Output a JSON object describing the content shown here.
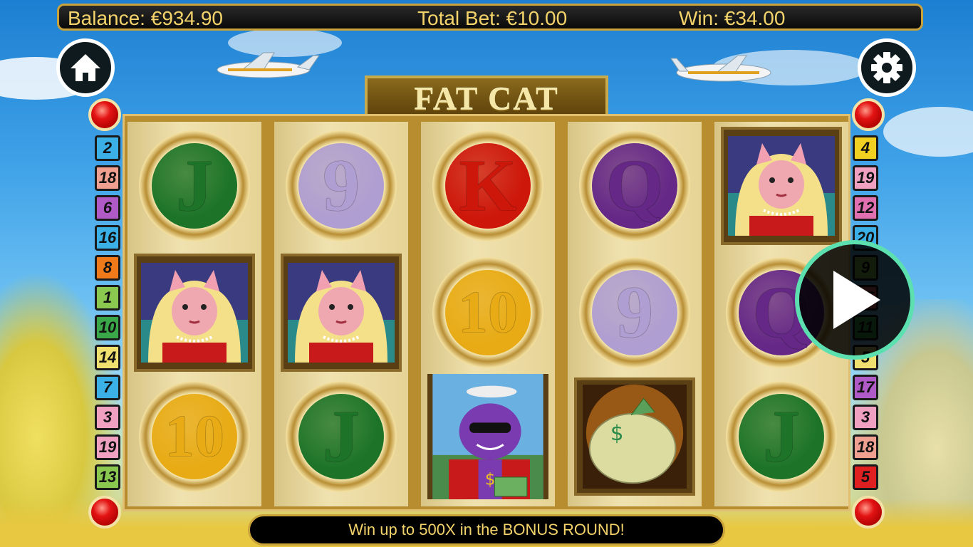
{
  "header": {
    "balance": "Balance: €934.90",
    "total_bet": "Total Bet: €10.00",
    "win": "Win: €34.00"
  },
  "logo": {
    "title": "FAT CAT"
  },
  "buttons": {
    "home_icon": "home-icon",
    "settings_icon": "gear-icon",
    "play_icon": "play-icon"
  },
  "reels": [
    [
      {
        "type": "coin",
        "label": "J",
        "color": "#1e7a2a"
      },
      {
        "type": "cat"
      },
      {
        "type": "coin",
        "label": "10",
        "color": "#f4b416"
      }
    ],
    [
      {
        "type": "coin",
        "label": "9",
        "color": "#b8a6dc"
      },
      {
        "type": "cat"
      },
      {
        "type": "coin",
        "label": "J",
        "color": "#1e7a2a"
      }
    ],
    [
      {
        "type": "coin",
        "label": "K",
        "color": "#d8180c"
      },
      {
        "type": "coin",
        "label": "10",
        "color": "#f4b416"
      },
      {
        "type": "fatcat"
      }
    ],
    [
      {
        "type": "coin",
        "label": "Q",
        "color": "#6a2a8e"
      },
      {
        "type": "coin",
        "label": "9",
        "color": "#b8a6dc"
      },
      {
        "type": "moneybag"
      }
    ],
    [
      {
        "type": "cat"
      },
      {
        "type": "coin",
        "label": "Q",
        "color": "#6a2a8e"
      },
      {
        "type": "coin",
        "label": "J",
        "color": "#1e7a2a"
      }
    ]
  ],
  "paylines_left": [
    {
      "n": "2",
      "color": "#3ab0e6"
    },
    {
      "n": "18",
      "color": "#f0a090"
    },
    {
      "n": "6",
      "color": "#b05ac8"
    },
    {
      "n": "16",
      "color": "#3ab0e6"
    },
    {
      "n": "8",
      "color": "#f07a1a"
    },
    {
      "n": "1",
      "color": "#8ac850"
    },
    {
      "n": "10",
      "color": "#3aa848"
    },
    {
      "n": "14",
      "color": "#f0e070"
    },
    {
      "n": "7",
      "color": "#3ab0e6"
    },
    {
      "n": "3",
      "color": "#f0a0c0"
    },
    {
      "n": "19",
      "color": "#f0a0c0"
    },
    {
      "n": "13",
      "color": "#8ac850"
    }
  ],
  "paylines_right": [
    {
      "n": "4",
      "color": "#f0d020"
    },
    {
      "n": "19",
      "color": "#f0a0c0"
    },
    {
      "n": "12",
      "color": "#e070b0"
    },
    {
      "n": "20",
      "color": "#3ab0e6"
    },
    {
      "n": "9",
      "color": "#8ac850"
    },
    {
      "n": "15",
      "color": "#e06060"
    },
    {
      "n": "11",
      "color": "#3aa848"
    },
    {
      "n": "5",
      "color": "#f0e070"
    },
    {
      "n": "17",
      "color": "#b05ac8"
    },
    {
      "n": "3",
      "color": "#f0a0c0"
    },
    {
      "n": "18",
      "color": "#f0a090"
    },
    {
      "n": "5",
      "color": "#e02020"
    }
  ],
  "banner": {
    "text": "Win up to 500X in the BONUS ROUND!"
  }
}
